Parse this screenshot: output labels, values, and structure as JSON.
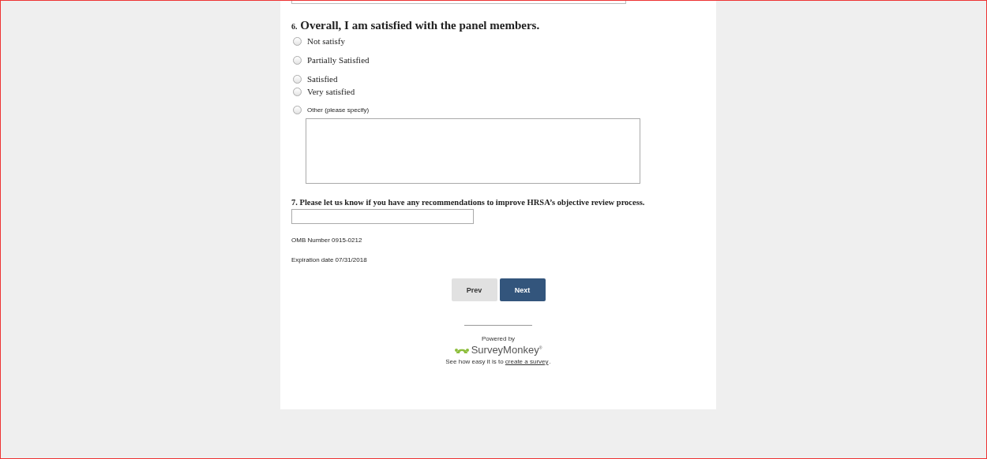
{
  "question6": {
    "number": "6.",
    "title": "Overall, I am satisfied with the panel members.",
    "options": [
      {
        "label": "Not satisfy",
        "selected": false
      },
      {
        "label": "Partially Satisfied",
        "selected": false
      },
      {
        "label": "Satisfied",
        "selected": false
      },
      {
        "label": "Very satisfied",
        "selected": false
      },
      {
        "label": "Other (please specify)",
        "selected": false,
        "kind": "other"
      }
    ]
  },
  "question7": {
    "title": "7. Please let us know if you have any recommendations to improve HRSA’s objective review process."
  },
  "notes": [
    "OMB Number 0915-0212",
    "Expiration date 07/31/2018"
  ],
  "buttons": {
    "prev": "Prev",
    "next": "Next"
  },
  "footer": {
    "powered_by": "Powered by",
    "brand": "SurveyMonkey$^{®}$",
    "tagline": "See how easy it is to ",
    "link": "create a survey",
    "end": "."
  }
}
